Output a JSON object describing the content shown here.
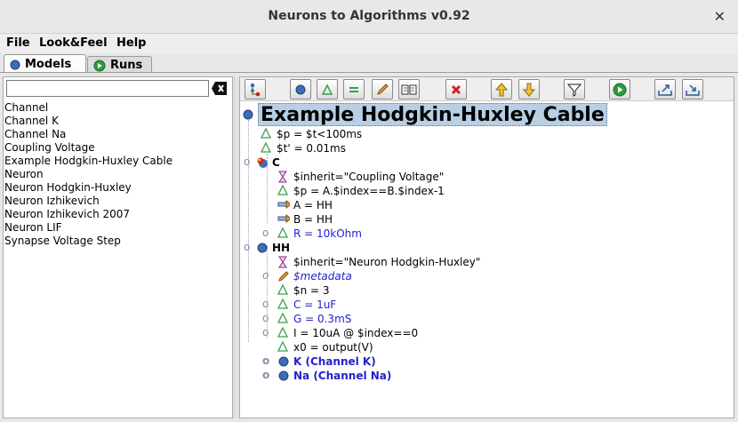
{
  "window": {
    "title": "Neurons to Algorithms v0.92",
    "close_glyph": "✕"
  },
  "menu": [
    "File",
    "Look&Feel",
    "Help"
  ],
  "tabs": [
    {
      "label": "Models",
      "icon": "blue-dot-icon",
      "active": true
    },
    {
      "label": "Runs",
      "icon": "green-play-icon",
      "active": false
    }
  ],
  "search": {
    "value": "",
    "placeholder": ""
  },
  "model_list": [
    "Channel",
    "Channel K",
    "Channel Na",
    "Coupling Voltage",
    "Example Hodgkin-Huxley Cable",
    "Neuron",
    "Neuron Hodgkin-Huxley",
    "Neuron Izhikevich",
    "Neuron Izhikevich 2007",
    "Neuron LIF",
    "Synapse Voltage Step"
  ],
  "toolbar": [
    "tree-view-icon",
    "add-part-icon",
    "add-variable-icon",
    "add-equation-icon",
    "edit-icon",
    "reference-book-icon",
    "delete-icon",
    "move-up-icon",
    "move-down-icon",
    "filter-icon",
    "run-icon",
    "export-icon",
    "import-icon"
  ],
  "tree": {
    "root": "Example Hodgkin-Huxley Cable",
    "rows": [
      {
        "text": "$p = $t<100ms",
        "icon": "variable-icon"
      },
      {
        "text": "$t' = 0.01ms",
        "icon": "variable-icon"
      },
      {
        "text": "C",
        "icon": "part-icon"
      },
      {
        "text": "$inherit=\"Coupling Voltage\"",
        "icon": "inherit-icon"
      },
      {
        "text": "$p = A.$index==B.$index-1",
        "icon": "variable-icon"
      },
      {
        "text": "A   = HH",
        "icon": "connection-icon"
      },
      {
        "text": "B   = HH",
        "icon": "connection-icon"
      },
      {
        "text": "R   = 10kOhm",
        "icon": "variable-icon"
      },
      {
        "text": "HH",
        "icon": "part-icon"
      },
      {
        "text": "$inherit=\"Neuron Hodgkin-Huxley\"",
        "icon": "inherit-icon"
      },
      {
        "text": "$metadata",
        "icon": "metadata-icon"
      },
      {
        "text": "$n = 3",
        "icon": "variable-icon"
      },
      {
        "text": "C   = 1uF",
        "icon": "variable-icon"
      },
      {
        "text": "G   = 0.3mS",
        "icon": "variable-icon"
      },
      {
        "text": "I    = 10uA @ $index==0",
        "icon": "variable-icon"
      },
      {
        "text": "x0 = output(V)",
        "icon": "variable-icon"
      },
      {
        "text": "K  (Channel K)",
        "icon": "part-icon"
      },
      {
        "text": "Na  (Channel Na)",
        "icon": "part-icon"
      }
    ]
  },
  "colors": {
    "selection": "#b8cfe5",
    "override_text": "#2222cc",
    "part": "#3a6fb5",
    "variable": "#3aa04a"
  }
}
